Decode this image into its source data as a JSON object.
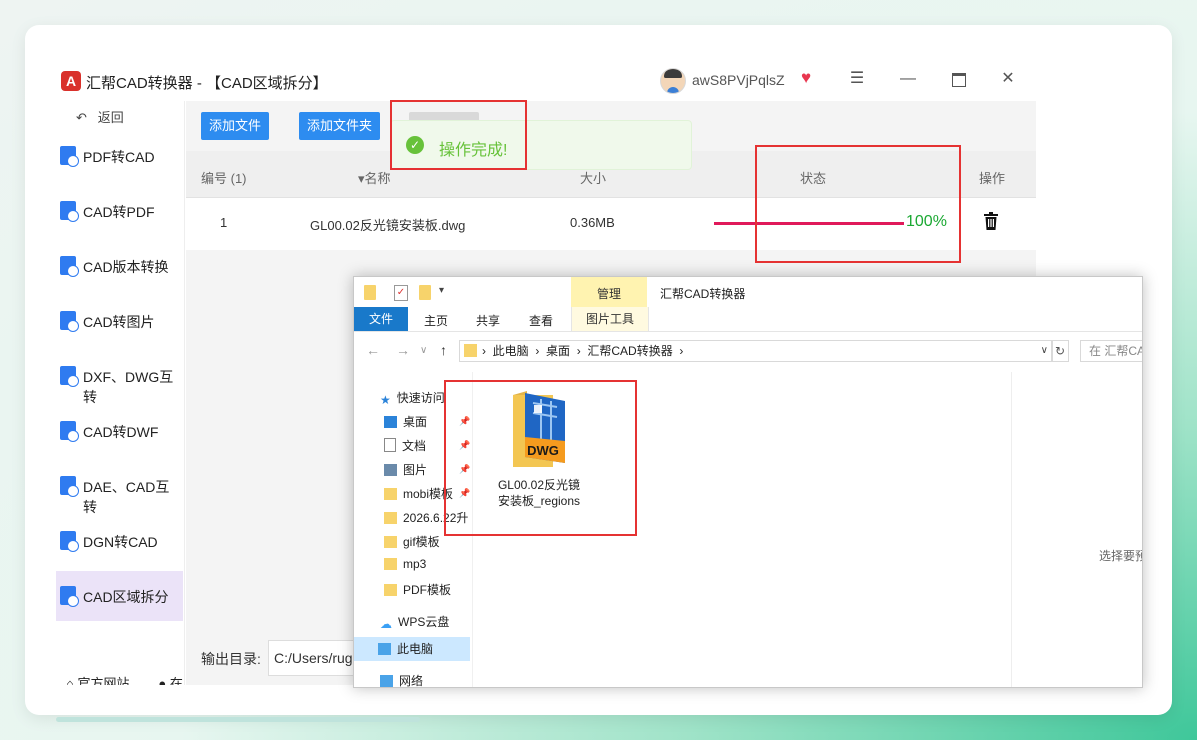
{
  "window": {
    "title": "汇帮CAD转换器 - 【CAD区域拆分】",
    "logo": "A",
    "username": "awS8PVjPqlsZ",
    "controls": {
      "menu": "☰",
      "minimize": "—",
      "close": "✕"
    }
  },
  "sidebar": {
    "back_label": "返回",
    "back_icon": "↶",
    "items": [
      {
        "label": "PDF转CAD"
      },
      {
        "label": "CAD转PDF"
      },
      {
        "label": "CAD版本转换"
      },
      {
        "label": "CAD转图片"
      },
      {
        "label": "DXF、DWG互转"
      },
      {
        "label": "CAD转DWF"
      },
      {
        "label": "DAE、CAD互转"
      },
      {
        "label": "DGN转CAD"
      },
      {
        "label": "CAD区域拆分"
      }
    ],
    "active_index": 8,
    "footer": {
      "website": "官方网站",
      "service": "在线客服"
    }
  },
  "toolbar": {
    "add_file": "添加文件",
    "add_folder": "添加文件夹"
  },
  "toast": {
    "icon": "✓",
    "message": "操作完成!"
  },
  "table": {
    "headers": {
      "number": "编号 (1)",
      "name": "名称",
      "size": "大小",
      "status": "状态",
      "action": "操作"
    },
    "rows": [
      {
        "number": "1",
        "name": "GL00.02反光镜安装板.dwg",
        "size": "0.36MB",
        "progress": 100,
        "progress_text": "100%"
      }
    ]
  },
  "output": {
    "label": "输出目录:",
    "path": "C:/Users/rug"
  },
  "explorer": {
    "title": "汇帮CAD转换器",
    "context_tab": "管理",
    "context_subtab": "图片工具",
    "ribbon_tabs": {
      "file": "文件",
      "home": "主页",
      "share": "共享",
      "view": "查看"
    },
    "breadcrumb": [
      "此电脑",
      "桌面",
      "汇帮CAD转换器"
    ],
    "search_placeholder": "在 汇帮CA",
    "tree": {
      "quick_access": "快速访问",
      "items": [
        "桌面",
        "文档",
        "图片",
        "mobi模板",
        "2026.6.22升",
        "gif模板",
        "mp3",
        "PDF模板"
      ],
      "wps": "WPS云盘",
      "this_pc": "此电脑",
      "network": "网络"
    },
    "file": {
      "name_line1": "GL00.02反光镜",
      "name_line2": "安装板_regions",
      "badge": "DWG"
    },
    "preview_hint": "选择要预"
  },
  "colors": {
    "accent_blue": "#2d8cf0",
    "progress": "#e0195a",
    "success": "#67c23a",
    "percent_green": "#1aa832",
    "highlight_red": "#e53232",
    "sidebar_active": "#ebe3f8"
  }
}
